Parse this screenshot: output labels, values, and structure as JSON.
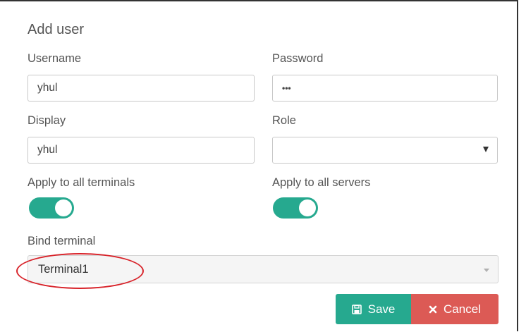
{
  "dialog": {
    "title": "Add user"
  },
  "form": {
    "username": {
      "label": "Username",
      "value": "yhul"
    },
    "password": {
      "label": "Password",
      "value": "•••"
    },
    "display": {
      "label": "Display",
      "value": "yhul"
    },
    "role": {
      "label": "Role",
      "value": ""
    },
    "apply_terminals": {
      "label": "Apply to all terminals",
      "enabled": true
    },
    "apply_servers": {
      "label": "Apply to all servers",
      "enabled": true
    },
    "bind_terminal": {
      "label": "Bind terminal",
      "value": "Terminal1"
    }
  },
  "actions": {
    "save_label": "Save",
    "cancel_label": "Cancel"
  },
  "colors": {
    "accent": "#26a98f",
    "danger": "#dc5a55",
    "annotation": "#d8232a"
  },
  "icons": {
    "save": "floppy-disk-icon",
    "cancel": "x-icon",
    "select": "caret-down-icon"
  }
}
